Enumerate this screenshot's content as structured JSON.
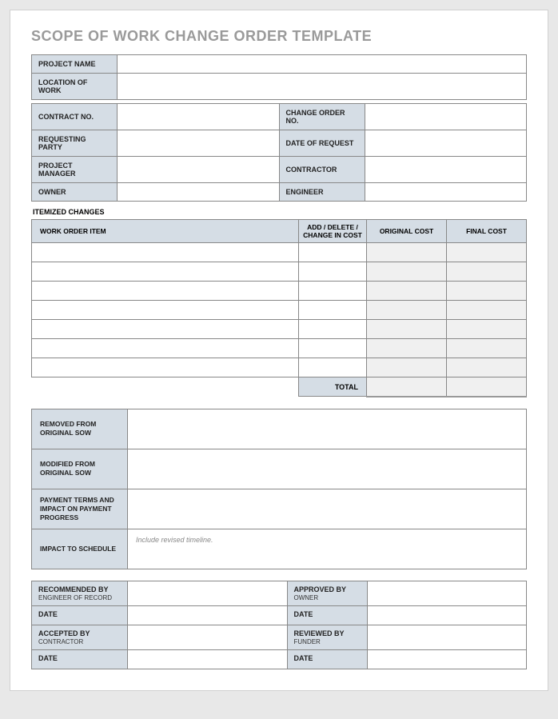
{
  "title": "SCOPE OF WORK CHANGE ORDER TEMPLATE",
  "header": {
    "project_name_label": "PROJECT NAME",
    "project_name": "",
    "location_label": "LOCATION OF WORK",
    "location": "",
    "contract_no_label": "CONTRACT NO.",
    "contract_no": "",
    "change_order_no_label": "CHANGE ORDER NO.",
    "change_order_no": "",
    "requesting_party_label": "REQUESTING PARTY",
    "requesting_party": "",
    "date_of_request_label": "DATE OF REQUEST",
    "date_of_request": "",
    "project_manager_label": "PROJECT MANAGER",
    "project_manager": "",
    "contractor_label": "CONTRACTOR",
    "contractor": "",
    "owner_label": "OWNER",
    "owner": "",
    "engineer_label": "ENGINEER",
    "engineer": ""
  },
  "itemized": {
    "heading": "ITEMIZED CHANGES",
    "cols": {
      "work_order_item": "WORK ORDER ITEM",
      "add_delete_change": "ADD / DELETE / CHANGE IN COST",
      "original_cost": "ORIGINAL COST",
      "final_cost": "FINAL COST"
    },
    "rows": [
      {
        "item": "",
        "change": "",
        "original": "",
        "final": ""
      },
      {
        "item": "",
        "change": "",
        "original": "",
        "final": ""
      },
      {
        "item": "",
        "change": "",
        "original": "",
        "final": ""
      },
      {
        "item": "",
        "change": "",
        "original": "",
        "final": ""
      },
      {
        "item": "",
        "change": "",
        "original": "",
        "final": ""
      },
      {
        "item": "",
        "change": "",
        "original": "",
        "final": ""
      },
      {
        "item": "",
        "change": "",
        "original": "",
        "final": ""
      }
    ],
    "total_label": "TOTAL",
    "total_original": "",
    "total_final": ""
  },
  "details": {
    "removed_label": "REMOVED FROM ORIGINAL SOW",
    "removed": "",
    "modified_label": "MODIFIED FROM ORIGINAL SOW",
    "modified": "",
    "payment_label": "PAYMENT TERMS AND IMPACT ON PAYMENT PROGRESS",
    "payment": "",
    "schedule_label": "IMPACT TO SCHEDULE",
    "schedule_placeholder": "Include revised timeline.",
    "schedule": ""
  },
  "signoff": {
    "recommended_label": "RECOMMENDED BY",
    "recommended_sub": "ENGINEER OF RECORD",
    "recommended": "",
    "approved_label": "APPROVED BY",
    "approved_sub": "OWNER",
    "approved": "",
    "date_label": "DATE",
    "date1": "",
    "date2": "",
    "accepted_label": "ACCEPTED BY",
    "accepted_sub": "CONTRACTOR",
    "accepted": "",
    "reviewed_label": "REVIEWED BY",
    "reviewed_sub": "FUNDER",
    "reviewed": "",
    "date3": "",
    "date4": ""
  }
}
